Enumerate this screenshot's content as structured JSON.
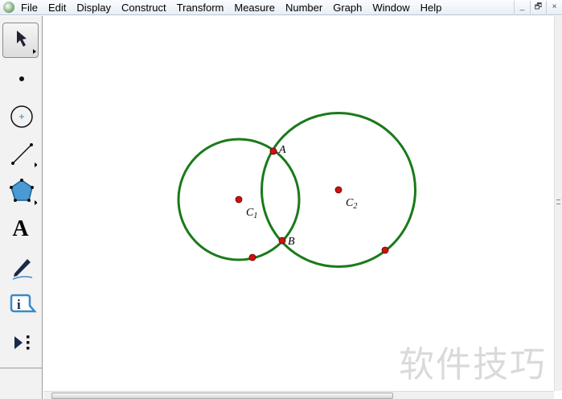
{
  "menubar": {
    "items": [
      "File",
      "Edit",
      "Display",
      "Construct",
      "Transform",
      "Measure",
      "Number",
      "Graph",
      "Window",
      "Help"
    ]
  },
  "window_buttons": {
    "minimize": "_",
    "restore": "🗗",
    "close": "×"
  },
  "toolbox": [
    "arrow-tool",
    "point-tool",
    "compass-tool",
    "straightedge-tool",
    "polygon-tool",
    "text-tool",
    "marker-tool",
    "information-tool",
    "custom-tool"
  ],
  "text_tool_label": "A",
  "sketch": {
    "points": {
      "A": "A",
      "B": "B",
      "C1": "C",
      "C1_sub": "1",
      "C2": "C",
      "C2_sub": "2"
    },
    "colors": {
      "circle": "#1a7a1a",
      "point": "#cc0000"
    }
  },
  "watermark": "软件技巧"
}
